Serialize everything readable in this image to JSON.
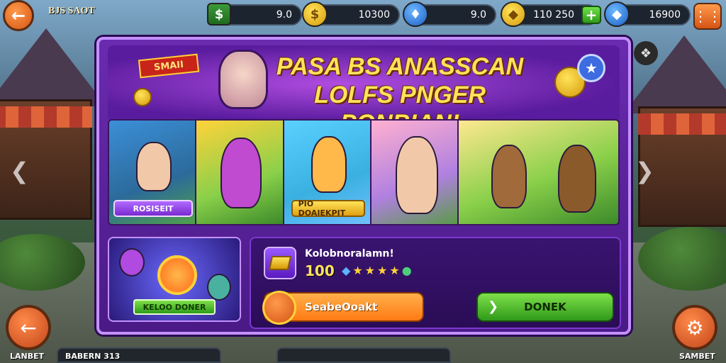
{
  "topbar": {
    "title": "BJS SAOT",
    "resources": [
      {
        "value": "9.0",
        "icon": "cash-icon"
      },
      {
        "value": "10300",
        "icon": "gold-coin-icon"
      },
      {
        "value": "9.0",
        "icon": "blue-shield-icon"
      },
      {
        "value": "110 250",
        "icon": "gold-shield-icon"
      },
      {
        "value": "16900",
        "icon": "blue-gem-icon"
      }
    ]
  },
  "banner": {
    "tag": "SMAII",
    "headline_line1": "PASA BS ANASSCAN",
    "headline_line2": "LOLFS PNGER PONBIAN!"
  },
  "cards": [
    {
      "label": "ROSISEIT"
    },
    {
      "label": "PIO DOAIEKPIT"
    }
  ],
  "bottom_left": {
    "label": "KELOO DONER"
  },
  "info": {
    "title": "Kolobnoralamn!",
    "amount": "100",
    "primary_label": "SeabeOoakt",
    "secondary_label": "DONEK"
  },
  "bottombar": {
    "left_label": "LANBET",
    "center_label": "BABERN 313",
    "right_label": "SAMBET"
  },
  "colors": {
    "panel": "#5a1fa0",
    "accent_orange": "#ff7a14",
    "accent_green": "#2e9a1a",
    "gold": "#ffd23a"
  }
}
